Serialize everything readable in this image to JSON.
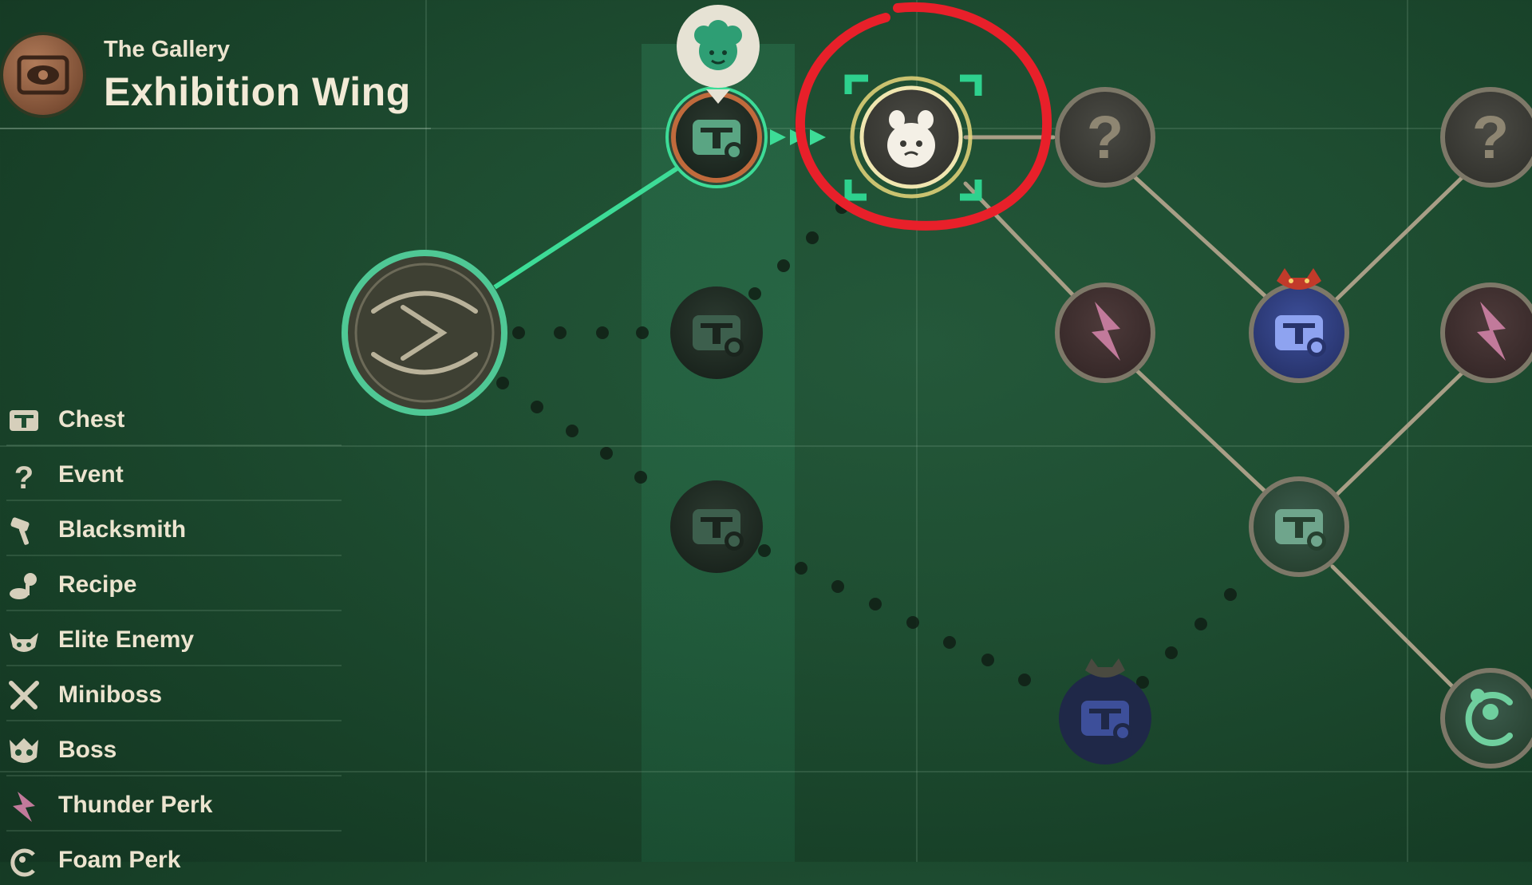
{
  "header": {
    "subtitle": "The Gallery",
    "title": "Exhibition Wing",
    "emblem_icon": "eye-emblem-icon"
  },
  "legend": [
    {
      "label": "Chest",
      "icon": "chest-icon"
    },
    {
      "label": "Event",
      "icon": "question-mark-icon"
    },
    {
      "label": "Blacksmith",
      "icon": "hammer-icon"
    },
    {
      "label": "Recipe",
      "icon": "recipe-icon"
    },
    {
      "label": "Elite Enemy",
      "icon": "elite-enemy-icon"
    },
    {
      "label": "Miniboss",
      "icon": "crossed-swords-icon"
    },
    {
      "label": "Boss",
      "icon": "boss-skull-icon"
    },
    {
      "label": "Thunder Perk",
      "icon": "lightning-icon"
    },
    {
      "label": "Foam Perk",
      "icon": "foam-icon"
    }
  ],
  "nodes": {
    "start": {
      "icon": "start-portal-icon"
    },
    "current_chest": {
      "icon": "chest-icon",
      "player_marker": "player-avatar-icon"
    },
    "selected": {
      "icon": "critter-enemy-icon",
      "annotation": "red-circle-annotation"
    },
    "event_top": {
      "label": "?",
      "icon": "question-mark-icon"
    },
    "event_top_right": {
      "label": "?",
      "icon": "question-mark-icon"
    },
    "chest_mid": {
      "icon": "chest-icon"
    },
    "chest_low": {
      "icon": "chest-icon"
    },
    "thunder_1": {
      "icon": "lightning-icon"
    },
    "elite_chest": {
      "icon": "elite-chest-icon"
    },
    "thunder_2": {
      "icon": "lightning-icon"
    },
    "chest_right": {
      "icon": "chest-icon"
    },
    "miniboss_chest": {
      "icon": "miniboss-chest-icon"
    },
    "foam_node": {
      "icon": "foam-icon"
    }
  },
  "colors": {
    "background": "#1e4d31",
    "path_active": "#3ddc97",
    "path_inactive": "#a89e86",
    "annotation": "#e8202a",
    "selection": "#e8d67a",
    "elite": "#4a63b8"
  }
}
